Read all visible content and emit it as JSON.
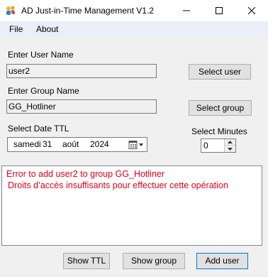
{
  "window": {
    "title": "AD Just-in-Time Management V1.2",
    "icon": "users-group-icon"
  },
  "menu": {
    "items": [
      "File",
      "About"
    ]
  },
  "user": {
    "label": "Enter User Name",
    "value": "user2",
    "button": "Select user"
  },
  "group": {
    "label": "Enter Group Name",
    "value": "GG_Hotliner",
    "button": "Select group"
  },
  "date": {
    "label": "Select Date TTL",
    "weekday": "samedi",
    "day": "31",
    "month": "août",
    "year": "2024",
    "icon": "calendar-dropdown-icon"
  },
  "minutes": {
    "label": "Select Minutes",
    "value": "0"
  },
  "output": {
    "lines": [
      "Error to add user2 to group GG_Hotliner",
      " Droits d’accès insuffisants pour effectuer cette opération"
    ],
    "color": "#e0001b"
  },
  "actions": {
    "show_ttl": "Show TTL",
    "show_group": "Show group",
    "add_user": "Add user"
  }
}
